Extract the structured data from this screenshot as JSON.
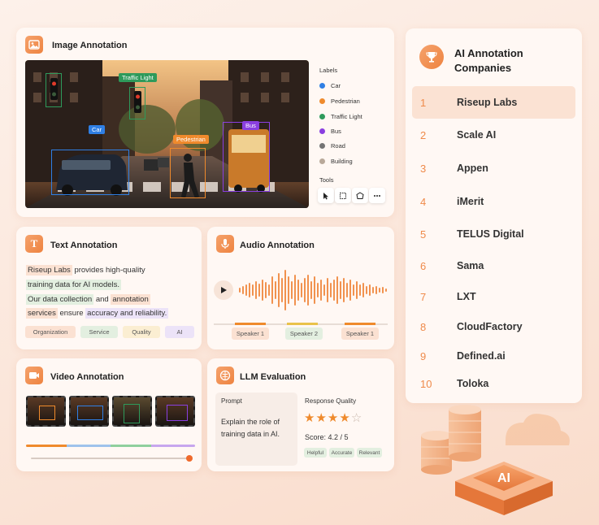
{
  "image_annotation": {
    "title": "Image Annotation",
    "icon": "image-icon",
    "labels_heading": "Labels",
    "labels": [
      {
        "name": "Car",
        "color": "#2f7fe4"
      },
      {
        "name": "Pedestrian",
        "color": "#ef8a2c"
      },
      {
        "name": "Traffic Light",
        "color": "#2e9a5b"
      },
      {
        "name": "Bus",
        "color": "#8a3fe0"
      },
      {
        "name": "Road",
        "color": "#747474"
      },
      {
        "name": "Building",
        "color": "#b9a99a"
      }
    ],
    "tools_heading": "Tools",
    "tools": [
      "pointer-icon",
      "select-box-icon",
      "polygon-icon",
      "more-icon"
    ],
    "tags": {
      "traffic_light": "Traffic Light",
      "car": "Car",
      "pedestrian": "Pedestrian",
      "bus": "Bus"
    }
  },
  "text_annotation": {
    "title": "Text Annotation",
    "icon": "text-icon",
    "lines": {
      "l1_ent": "Riseup Labs",
      "l1_rest": " provides high-quality",
      "l2_ent": "training data for AI models.",
      "l3_ent": "Our data collection",
      "l3_mid": " and ",
      "l3_ent2": "annotation",
      "l4_ent": "services",
      "l4_mid": " ensure ",
      "l4_ent2": "accuracy and reliability."
    },
    "chips": [
      {
        "label": "Organization",
        "color": "#fbe1d2"
      },
      {
        "label": "Service",
        "color": "#e3efe0"
      },
      {
        "label": "Quality",
        "color": "#fbeed2"
      },
      {
        "label": "AI",
        "color": "#ece3f8"
      }
    ]
  },
  "audio_annotation": {
    "title": "Audio Annotation",
    "icon": "microphone-icon",
    "speakers": [
      "Speaker 1",
      "Speaker 2",
      "Speaker 1"
    ]
  },
  "video_annotation": {
    "title": "Video Annotation",
    "icon": "video-camera-icon"
  },
  "llm_evaluation": {
    "title": "LLM Evaluation",
    "icon": "brain-icon",
    "prompt_heading": "Prompt",
    "prompt_text_1": "Explain the role of",
    "prompt_text_2": "training data in AI.",
    "quality_heading": "Response Quality",
    "stars_filled": 4,
    "stars_total": 5,
    "score": "Score: 4.2 / 5",
    "tags": [
      "Helpful",
      "Accurate",
      "Relevant"
    ]
  },
  "companies": {
    "title_line1": "AI Annotation",
    "title_line2": "Companies",
    "icon": "trophy-icon",
    "items": [
      {
        "rank": "1",
        "name": "Riseup Labs"
      },
      {
        "rank": "2",
        "name": "Scale AI"
      },
      {
        "rank": "3",
        "name": "Appen"
      },
      {
        "rank": "4",
        "name": "iMerit"
      },
      {
        "rank": "5",
        "name": "TELUS Digital"
      },
      {
        "rank": "6",
        "name": "Sama"
      },
      {
        "rank": "7",
        "name": "LXT"
      },
      {
        "rank": "8",
        "name": "CloudFactory"
      },
      {
        "rank": "9",
        "name": "Defined.ai"
      },
      {
        "rank": "10",
        "name": "Toloka"
      }
    ]
  },
  "ai_cube_label": "AI",
  "accent_color": "#ee8340"
}
